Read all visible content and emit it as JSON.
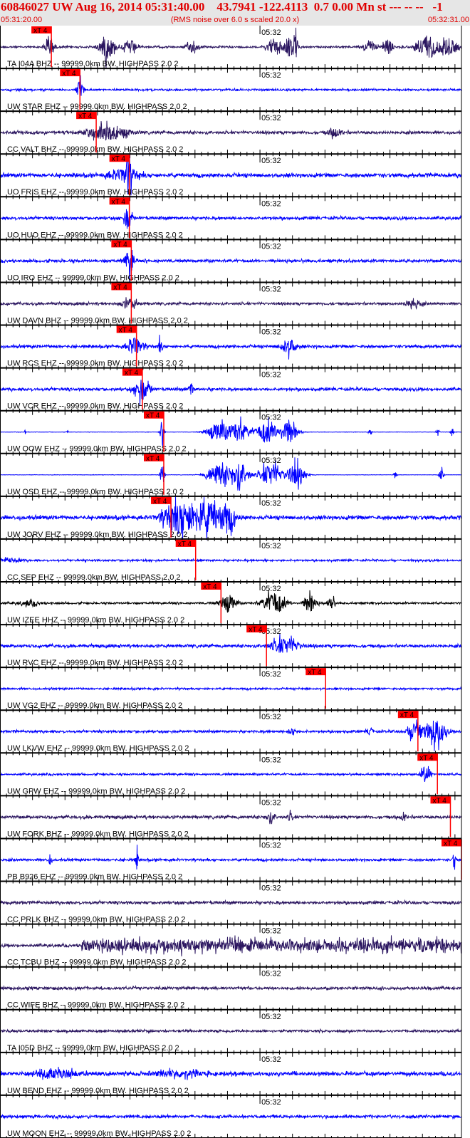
{
  "header": {
    "title": "60846027 UW Aug 16, 2014 05:31:40.00    43.7941 -122.4113  0.7 0.00 Mn st --- -- --   -1",
    "start_time": "05:31:20.00",
    "note": "(RMS noise over 6.0 s scaled 20.0 x)",
    "end_time": "05:32:31.00"
  },
  "chart_data": {
    "type": "line",
    "x_range": [
      "05:31:20.00",
      "05:32:31.00"
    ],
    "time_tick_label": "05:32",
    "colors": {
      "blue": "#0000ff",
      "dark": "#2b1660",
      "black": "#000000",
      "pick": "#ff0000"
    },
    "traces": [
      {
        "label": "TA I04A BHZ -- 99999.0km BW. HIGHPASS  2.0  2",
        "color": "#2b1660",
        "pick_label": "xT 4",
        "pick_time": "05:31:27.9"
      },
      {
        "label": "UW STAR EHZ -- 99999.0km BW. HIGHPASS  2.0  2",
        "color": "#0000ff",
        "pick_label": "xT 4",
        "pick_time": "05:31:32.3"
      },
      {
        "label": "CC VALT BHZ -- 99999.0km BW. HIGHPASS  2.0  2",
        "color": "#2b1660",
        "pick_label": "xT 4",
        "pick_time": "05:31:34.8"
      },
      {
        "label": "UO FRIS EHZ -- 99999.0km BW. HIGHPASS  2.0  2",
        "color": "#0000ff",
        "pick_label": "xT 4",
        "pick_time": "05:31:39.9"
      },
      {
        "label": "UO HUO EHZ -- 99999.0km BW. HIGHPASS  2.0  2",
        "color": "#0000ff",
        "pick_label": "xT 4",
        "pick_time": "05:31:39.9"
      },
      {
        "label": "UO IRO EHZ -- 99999.0km BW. HIGHPASS  2.0  2",
        "color": "#0000ff",
        "pick_label": "xT 4",
        "pick_time": "05:31:40.2"
      },
      {
        "label": "UW DAVN BHZ -- 99999.0km BW. HIGHPASS  2.0  2",
        "color": "#2b1660",
        "pick_label": "xT 4",
        "pick_time": "05:31:40.2"
      },
      {
        "label": "UW RCS EHZ -- 99999.0km BW. HIGHPASS  2.0  2",
        "color": "#0000ff",
        "pick_label": "xT 4",
        "pick_time": "05:31:41.0"
      },
      {
        "label": "UW VCR EHZ -- 99999.0km BW. HIGHPASS  2.0  2",
        "color": "#0000ff",
        "pick_label": "xT 4",
        "pick_time": "05:31:41.9"
      },
      {
        "label": "UW OOW EHZ -- 99999.0km BW. HIGHPASS  2.0  2",
        "color": "#0000ff",
        "pick_label": "xT 4",
        "pick_time": "05:31:45.2"
      },
      {
        "label": "UW OSD EHZ -- 99999.0km BW. HIGHPASS  2.0  2",
        "color": "#0000ff",
        "pick_label": "xT 4",
        "pick_time": "05:31:45.2"
      },
      {
        "label": "UW JORV EHZ -- 99999.0km BW. HIGHPASS  2.0  2",
        "color": "#0000ff",
        "pick_label": "xT 4",
        "pick_time": "05:31:46.3"
      },
      {
        "label": "CC SEP EHZ -- 99999.0km BW. HIGHPASS  2.0  2",
        "color": "#0000ff",
        "pick_label": "xT 4",
        "pick_time": "05:31:50.1"
      },
      {
        "label": "UW IZEE HHZ -- 99999.0km BW. HIGHPASS  2.0  2",
        "color": "#000000",
        "pick_label": "xT 4",
        "pick_time": "05:31:54.0"
      },
      {
        "label": "UW RVC EHZ -- 99999.0km BW. HIGHPASS  2.0  2",
        "color": "#0000ff",
        "pick_label": "xT 4",
        "pick_time": "05:32:01.0"
      },
      {
        "label": "UW VG2 EHZ -- 99999.0km BW. HIGHPASS  2.0  2",
        "color": "#0000ff",
        "pick_label": "xT 4",
        "pick_time": "05:32:10.1"
      },
      {
        "label": "UW LKVW EHZ -- 99999.0km BW. HIGHPASS  2.0  2",
        "color": "#0000ff",
        "pick_label": "xT 4",
        "pick_time": "05:32:24.3"
      },
      {
        "label": "UW GPW EHZ -- 99999.0km BW. HIGHPASS  2.0  2",
        "color": "#0000ff",
        "pick_label": "xT 4",
        "pick_time": "05:32:27.3"
      },
      {
        "label": "UW FORK BHZ -- 99999.0km BW. HIGHPASS  2.0  2",
        "color": "#2b1660",
        "pick_label": "xT 4",
        "pick_time": "05:32:29.3"
      },
      {
        "label": "PB B926 EHZ -- 99999.0km BW. HIGHPASS  2.0  2",
        "color": "#0000ff",
        "pick_label": "xT 4",
        "pick_time": "05:32:31.0"
      },
      {
        "label": "CC PRLK BHZ -- 99999.0km BW. HIGHPASS  2.0  2",
        "color": "#2b1660"
      },
      {
        "label": "CC TCBU BHZ -- 99999.0km BW. HIGHPASS  2.0  2",
        "color": "#2b1660"
      },
      {
        "label": "CC WIFE BHZ -- 99999.0km BW. HIGHPASS  2.0  2",
        "color": "#2b1660"
      },
      {
        "label": "TA I05D BHZ -- 99999.0km BW. HIGHPASS  2.0  2",
        "color": "#2b1660"
      },
      {
        "label": "UW BEND EHZ -- 99999.0km BW. HIGHPASS  2.0  2",
        "color": "#0000ff"
      },
      {
        "label": "UW MOON EHZ -- 99999.0km BW. HIGHPASS  2.0  2",
        "color": "#0000ff"
      }
    ]
  }
}
